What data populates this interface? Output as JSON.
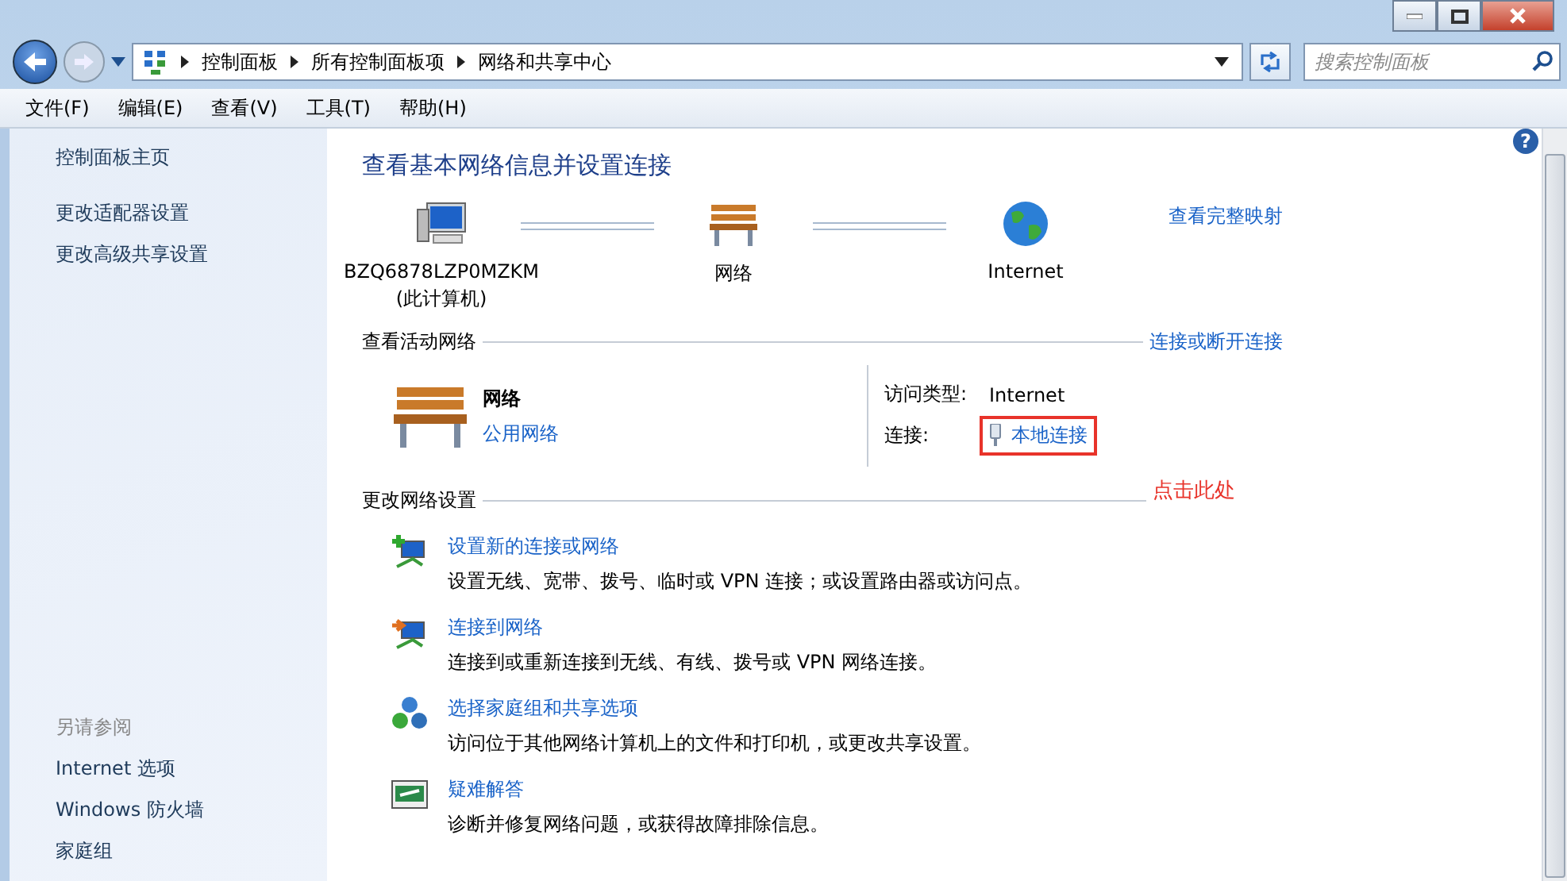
{
  "address_bar": {
    "breadcrumbs": [
      "控制面板",
      "所有控制面板项",
      "网络和共享中心"
    ],
    "search": {
      "placeholder": "搜索控制面板"
    }
  },
  "menu": [
    "文件(F)",
    "编辑(E)",
    "查看(V)",
    "工具(T)",
    "帮助(H)"
  ],
  "sidebar": {
    "links": [
      "控制面板主页",
      "更改适配器设置",
      "更改高级共享设置"
    ],
    "see_also": {
      "heading": "另请参阅",
      "links": [
        "Internet 选项",
        "Windows 防火墙",
        "家庭组"
      ]
    }
  },
  "main": {
    "help": "?",
    "title": "查看基本网络信息并设置连接",
    "map_link": "查看完整映射",
    "map_nodes": [
      {
        "kind": "computer",
        "label": "BZQ6878LZP0MZKM",
        "sublabel": "(此计算机)"
      },
      {
        "kind": "network",
        "label": "网络"
      },
      {
        "kind": "internet",
        "label": "Internet"
      }
    ],
    "active_networks": {
      "heading": "查看活动网络",
      "link": "连接或断开连接",
      "network": {
        "name": "网络",
        "type": "公用网络"
      },
      "properties": [
        {
          "kind": "text",
          "label": "访问类型:",
          "value": "Internet",
          "highlighted": false
        },
        {
          "kind": "link",
          "label": "连接:",
          "value": "本地连接",
          "highlighted": true
        }
      ]
    },
    "annotation": "点击此处",
    "change_settings": {
      "heading": "更改网络设置",
      "items": [
        {
          "kind": "new-connection",
          "title": "设置新的连接或网络",
          "description": "设置无线、宽带、拨号、临时或 VPN 连接；或设置路由器或访问点。"
        },
        {
          "kind": "connect",
          "title": "连接到网络",
          "description": "连接到或重新连接到无线、有线、拨号或 VPN 网络连接。"
        },
        {
          "kind": "homegroup",
          "title": "选择家庭组和共享选项",
          "description": "访问位于其他网络计算机上的文件和打印机，或更改共享设置。"
        },
        {
          "kind": "troubleshoot",
          "title": "疑难解答",
          "description": "诊断并修复网络问题，或获得故障排除信息。"
        }
      ]
    }
  }
}
